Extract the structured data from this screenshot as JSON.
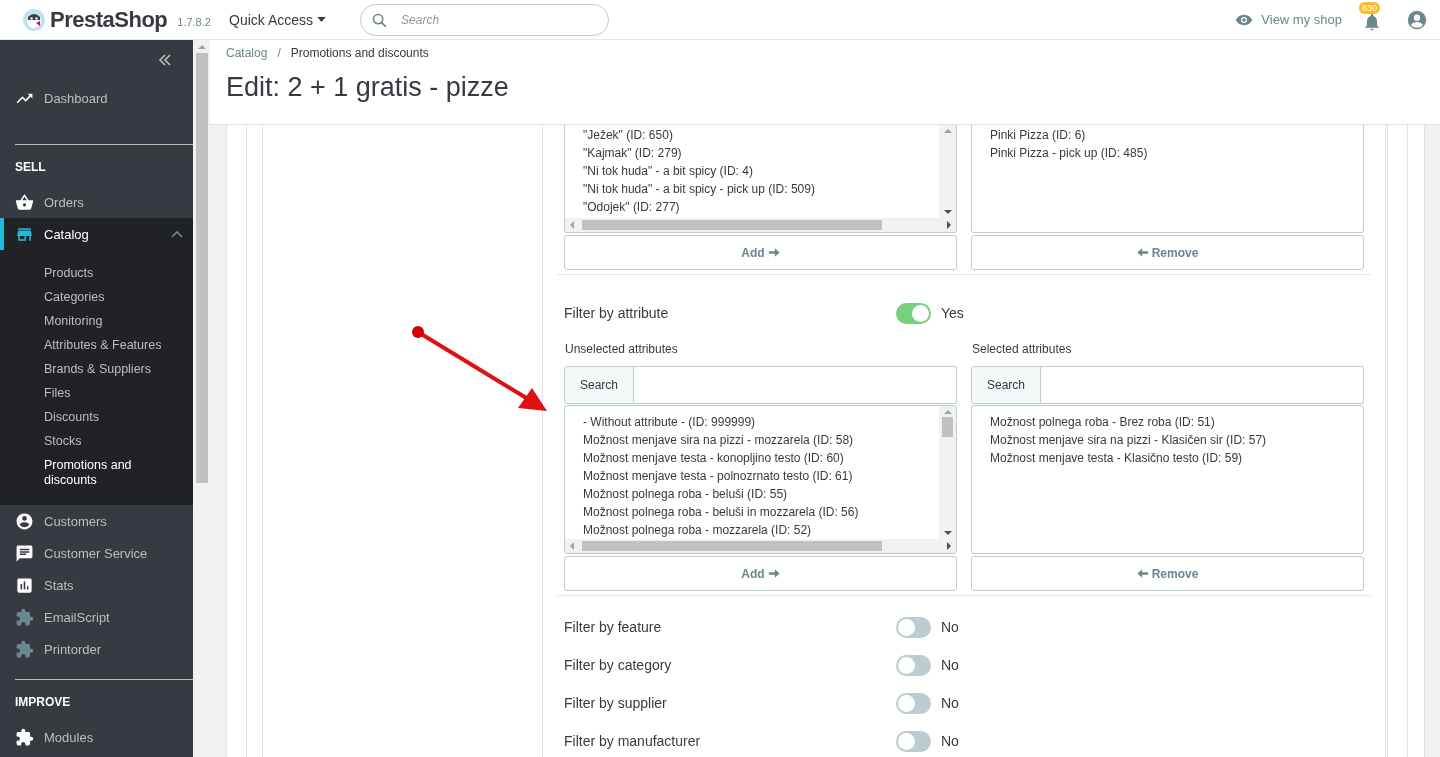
{
  "header": {
    "brand": "PrestaShop",
    "version": "1.7.8.2",
    "quick_access": "Quick Access",
    "search": {
      "placeholder": "Search"
    },
    "view_shop": "View my shop",
    "notifications_count": "830"
  },
  "sidebar": {
    "items": [
      {
        "kind": "link",
        "label": "Dashboard",
        "selected": false
      },
      {
        "kind": "heading",
        "label": "SELL"
      },
      {
        "kind": "link",
        "label": "Orders",
        "selected": false
      },
      {
        "kind": "link",
        "label": "Catalog",
        "selected": true,
        "expanded": true,
        "children": [
          {
            "label": "Products",
            "selected": false
          },
          {
            "label": "Categories",
            "selected": false
          },
          {
            "label": "Monitoring",
            "selected": false
          },
          {
            "label": "Attributes & Features",
            "selected": false
          },
          {
            "label": "Brands & Suppliers",
            "selected": false
          },
          {
            "label": "Files",
            "selected": false
          },
          {
            "label": "Discounts",
            "selected": false
          },
          {
            "label": "Stocks",
            "selected": false
          },
          {
            "label": "Promotions and discounts",
            "selected": true
          }
        ]
      },
      {
        "kind": "link",
        "label": "Customers",
        "selected": false
      },
      {
        "kind": "link",
        "label": "Customer Service",
        "selected": false
      },
      {
        "kind": "link",
        "label": "Stats",
        "selected": false
      },
      {
        "kind": "link",
        "label": "EmailScript",
        "selected": false
      },
      {
        "kind": "link",
        "label": "Printorder",
        "selected": false
      },
      {
        "kind": "heading",
        "label": "IMPROVE"
      },
      {
        "kind": "link",
        "label": "Modules",
        "selected": false
      }
    ]
  },
  "breadcrumb": [
    "Catalog",
    "Promotions and discounts"
  ],
  "breadcrumb_separator": "/",
  "title": "Edit: 2 + 1 gratis - pizze",
  "product_picker": {
    "unselected_items": [
      "\"Ježek\" (ID: 650)",
      "\"Kajmak\" (ID: 279)",
      "\"Ni tok huda\" - a bit spicy (ID: 4)",
      "\"Ni tok huda\" - a bit spicy - pick up (ID: 509)",
      "\"Odojek\" (ID: 277)"
    ],
    "selected_items": [
      "Pinki Pizza (ID: 6)",
      "Pinki Pizza - pick up (ID: 485)"
    ],
    "add_label": "Add",
    "remove_label": "Remove"
  },
  "filters": [
    {
      "label": "Filter by attribute",
      "on": true,
      "state_label": "Yes",
      "picker": {
        "unselected_heading": "Unselected attributes",
        "selected_heading": "Selected attributes",
        "unselected_search_label": "Search",
        "selected_search_label": "Search",
        "unselected_items": [
          "- Without attribute - (ID: 999999)",
          "Možnost menjave sira na pizzi - mozzarela (ID: 58)",
          "Možnost menjave testa - konopljino testo (ID: 60)",
          "Možnost menjave testa - polnozrnato testo (ID: 61)",
          "Možnost polnega roba - beluši (ID: 55)",
          "Možnost polnega roba - beluši in mozzarela (ID: 56)",
          "Možnost polnega roba - mozzarela (ID: 52)"
        ],
        "selected_items": [
          "Možnost polnega roba - Brez roba (ID: 51)",
          "Možnost menjave sira na pizzi - Klasičen sir (ID: 57)",
          "Možnost menjave testa - Klasično testo (ID: 59)"
        ],
        "add_label": "Add",
        "remove_label": "Remove"
      }
    },
    {
      "label": "Filter by feature",
      "on": false,
      "state_label": "No"
    },
    {
      "label": "Filter by category",
      "on": false,
      "state_label": "No"
    },
    {
      "label": "Filter by supplier",
      "on": false,
      "state_label": "No"
    },
    {
      "label": "Filter by manufacturer",
      "on": false,
      "state_label": "No"
    }
  ]
}
